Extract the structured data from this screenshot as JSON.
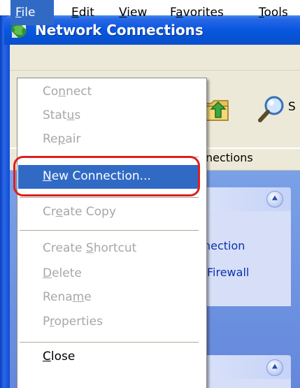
{
  "window": {
    "title": "Network Connections",
    "title_icon": "network-connections-icon"
  },
  "menubar": {
    "items": [
      {
        "label": "File"
      },
      {
        "label": "Edit"
      },
      {
        "label": "View"
      },
      {
        "label": "Favorites"
      },
      {
        "label": "Tools"
      }
    ]
  },
  "toolbar": {
    "folder_up_icon": "folder-up-icon",
    "search_icon": "search-icon",
    "search_label_fragment": "S"
  },
  "address": {
    "text_fragment": "nections"
  },
  "file_menu": {
    "items": [
      {
        "label": "Connect",
        "enabled": false
      },
      {
        "label": "Status",
        "enabled": false
      },
      {
        "label": "Repair",
        "enabled": false
      },
      {
        "label": "New Connection...",
        "enabled": true,
        "selected": true
      },
      {
        "label": "Create Copy",
        "enabled": false
      },
      {
        "label": "Create Shortcut",
        "enabled": false
      },
      {
        "label": "Delete",
        "enabled": false
      },
      {
        "label": "Rename",
        "enabled": false
      },
      {
        "label": "Properties",
        "enabled": false
      },
      {
        "label": "Close",
        "enabled": true
      }
    ]
  },
  "task_pane": {
    "links": [
      {
        "label": "nection"
      },
      {
        "label": "Firewall"
      }
    ]
  },
  "colors": {
    "selection": "#316ac5",
    "annotation": "#dd1f1f",
    "titlebar": "#0654d6",
    "menubar": "#ece9d8"
  }
}
